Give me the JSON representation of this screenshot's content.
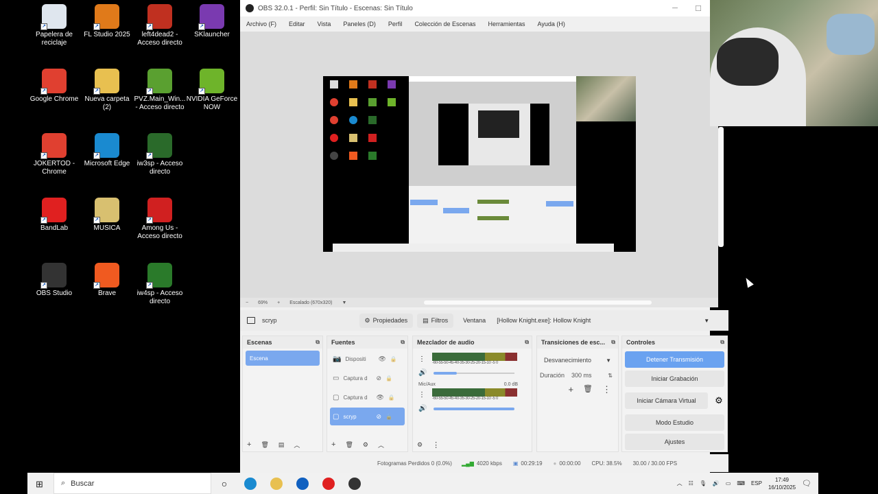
{
  "desktop": {
    "icons": [
      {
        "label": "Papelera de reciclaje",
        "icon": "recycle-bin-icon",
        "color": "#dfe6ee"
      },
      {
        "label": "FL Studio 2025",
        "icon": "fl-studio-icon",
        "color": "#e07a1a"
      },
      {
        "label": "left4dead2 - Acceso directo",
        "icon": "left4dead2-icon",
        "color": "#c03020"
      },
      {
        "label": "SKlauncher",
        "icon": "sklauncher-icon",
        "color": "#7a3ab0"
      },
      {
        "label": "Google Chrome",
        "icon": "chrome-icon",
        "color": "#e04030"
      },
      {
        "label": "Nueva carpeta (2)",
        "icon": "folder-icon",
        "color": "#e8c050"
      },
      {
        "label": "PVZ.Main_Win... - Acceso directo",
        "icon": "pvz-icon",
        "color": "#5aa030"
      },
      {
        "label": "NVIDIA GeForce NOW",
        "icon": "nvidia-icon",
        "color": "#6eb42a"
      },
      {
        "label": "JOKERTOD - Chrome",
        "icon": "chrome-icon",
        "color": "#e04030"
      },
      {
        "label": "Microsoft Edge",
        "icon": "edge-icon",
        "color": "#1a8ad0"
      },
      {
        "label": "iw3sp - Acceso directo",
        "icon": "iw3sp-icon",
        "color": "#2a6a2a"
      },
      {
        "label": "BandLab",
        "icon": "bandlab-icon",
        "color": "#e02020"
      },
      {
        "label": "MUSICA",
        "icon": "folder-icon",
        "color": "#d8c070"
      },
      {
        "label": "Among Us - Acceso directo",
        "icon": "among-us-icon",
        "color": "#d02020"
      },
      {
        "label": "OBS Studio",
        "icon": "obs-icon",
        "color": "#333333"
      },
      {
        "label": "Brave",
        "icon": "brave-icon",
        "color": "#f05a20"
      },
      {
        "label": "iw4sp - Acceso directo",
        "icon": "iw4sp-icon",
        "color": "#2a7a2a"
      }
    ]
  },
  "obs": {
    "title": "OBS 32.0.1 - Perfil: Sin Título - Escenas: Sin Título",
    "menu": [
      "Archivo (F)",
      "Editar",
      "Vista",
      "Paneles (D)",
      "Perfil",
      "Colección de Escenas",
      "Herramientas",
      "Ayuda (H)"
    ],
    "zoom": "69%",
    "scaled": "Escalado (670x320)",
    "source_bar": {
      "selected_source": "scryp",
      "properties": "Propiedades",
      "filters": "Filtros",
      "window_label": "Ventana",
      "window_value": "[Hollow Knight.exe]: Hollow Knight"
    },
    "scenes": {
      "title": "Escenas",
      "items": [
        "Escena"
      ]
    },
    "sources": {
      "title": "Fuentes",
      "items": [
        {
          "name": "Dispositi",
          "icon": "camera-icon",
          "visible": true,
          "selected": false
        },
        {
          "name": "Captura d",
          "icon": "monitor-icon",
          "visible": false,
          "selected": false
        },
        {
          "name": "Captura d",
          "icon": "window-icon",
          "visible": true,
          "selected": false
        },
        {
          "name": "scryp",
          "icon": "window-icon",
          "visible": false,
          "selected": true
        }
      ]
    },
    "mixer": {
      "title": "Mezclador de audio",
      "ticks": "-60-55-50-45-40-35-30-25-20-15-10 -5  0",
      "channels": [
        {
          "name": "",
          "db": ""
        },
        {
          "name": "Mic/Aux",
          "db": "0.0 dB"
        }
      ]
    },
    "transitions": {
      "title": "Transiciones de esc...",
      "selected": "Desvanecimiento",
      "duration_label": "Duración",
      "duration_value": "300 ms"
    },
    "controls": {
      "title": "Controles",
      "buttons": [
        "Detener Transmisión",
        "Iniciar Grabación",
        "Iniciar Cámara Virtual",
        "Modo Estudio",
        "Ajustes"
      ]
    },
    "status": {
      "dropped": "Fotogramas Perdidos 0 (0.0%)",
      "bitrate": "4020 kbps",
      "stream_time": "00:29:19",
      "rec_time": "00:00:00",
      "cpu": "CPU: 38.5%",
      "fps": "30.00 / 30.00 FPS"
    }
  },
  "taskbar": {
    "search_placeholder": "Buscar",
    "apps": [
      {
        "icon": "edge-icon",
        "color": "#1a8ad0"
      },
      {
        "icon": "file-explorer-icon",
        "color": "#e8c050"
      },
      {
        "icon": "outlook-icon",
        "color": "#1060c0"
      },
      {
        "icon": "bandlab-icon",
        "color": "#e02020"
      },
      {
        "icon": "obs-icon",
        "color": "#333333"
      }
    ],
    "lang": "ESP",
    "time": "17:49",
    "date": "16/10/2025"
  }
}
